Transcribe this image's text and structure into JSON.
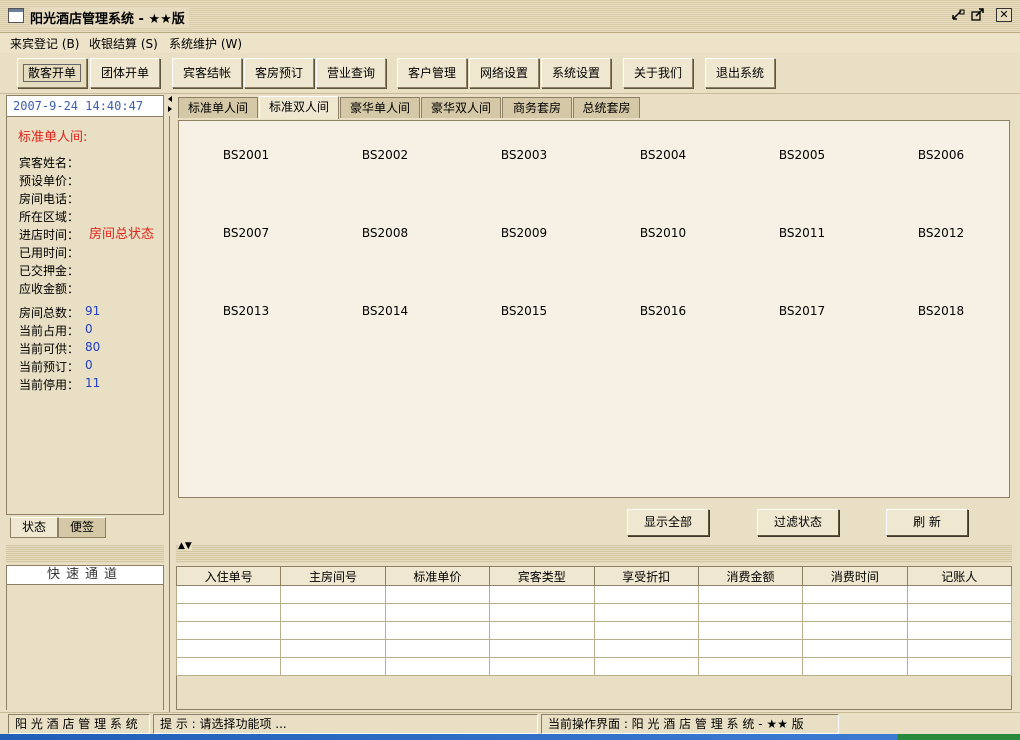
{
  "window": {
    "title": "阳光酒店管理系统 - ★★版",
    "controls": [
      "minimize-icon",
      "restore-icon",
      "close-icon"
    ]
  },
  "menu": [
    {
      "label": "来宾登记 (B)"
    },
    {
      "label": "收银结算 (S)"
    },
    {
      "label": "系统维护 (W)"
    }
  ],
  "toolbar": {
    "walkin_checkin": "散客开单",
    "group_checkin": "团体开单",
    "guest_checkout": "宾客结帐",
    "room_booking": "客房预订",
    "business_query": "营业查询",
    "customer_mgmt": "客户管理",
    "network_settings": "网络设置",
    "system_settings": "系统设置",
    "about_us": "关于我们",
    "exit_system": "退出系统"
  },
  "left_panel": {
    "datetime": "2007-9-24 14:40:47",
    "room_type": "标准单人间:",
    "room_status_label": "房间总状态",
    "fields": [
      "宾客姓名：",
      "预设单价：",
      "房间电话：",
      "所在区域：",
      "进店时间：",
      "已用时间：",
      "已交押金：",
      "应收金额："
    ],
    "stats": [
      {
        "label": "房间总数：",
        "value": "91"
      },
      {
        "label": "当前占用：",
        "value": "0"
      },
      {
        "label": "当前可供：",
        "value": "80"
      },
      {
        "label": "当前预订：",
        "value": "0"
      },
      {
        "label": "当前停用：",
        "value": "11"
      }
    ],
    "tabs": [
      "状态",
      "便签"
    ],
    "quick_channel": "快速通道"
  },
  "room_tabs": [
    "标准单人间",
    "标准双人间",
    "豪华单人间",
    "豪华双人间",
    "商务套房",
    "总统套房"
  ],
  "active_room_tab": "标准双人间",
  "rooms": [
    "BS2001",
    "BS2002",
    "BS2003",
    "BS2004",
    "BS2005",
    "BS2006",
    "BS2007",
    "BS2008",
    "BS2009",
    "BS2010",
    "BS2011",
    "BS2012",
    "BS2013",
    "BS2014",
    "BS2015",
    "BS2016",
    "BS2017",
    "BS2018"
  ],
  "actions": {
    "show_all": "显示全部",
    "filter_status": "过滤状态",
    "refresh": "刷  新"
  },
  "log_table": {
    "columns": [
      "入住单号",
      "主房间号",
      "标准单价",
      "宾客类型",
      "享受折扣",
      "消费金额",
      "消费时间",
      "记账人"
    ],
    "rows": [
      [
        "",
        "",
        "",
        "",
        "",
        "",
        "",
        ""
      ],
      [
        "",
        "",
        "",
        "",
        "",
        "",
        "",
        ""
      ],
      [
        "",
        "",
        "",
        "",
        "",
        "",
        "",
        ""
      ],
      [
        "",
        "",
        "",
        "",
        "",
        "",
        "",
        ""
      ],
      [
        "",
        "",
        "",
        "",
        "",
        "",
        "",
        ""
      ]
    ]
  },
  "statusbar": {
    "app_name": "阳 光 酒 店 管 理 系 统",
    "hint": "提 示 : 请选择功能项 ...",
    "current_view": "当前操作界面 : 阳 光 酒 店 管 理 系 统 -  ★★ 版"
  },
  "colors": {
    "background": "#e9dfc4",
    "accent_red": "#e0241b",
    "accent_blue": "#1f3fc2",
    "datetime_blue": "#3a5fb0"
  }
}
